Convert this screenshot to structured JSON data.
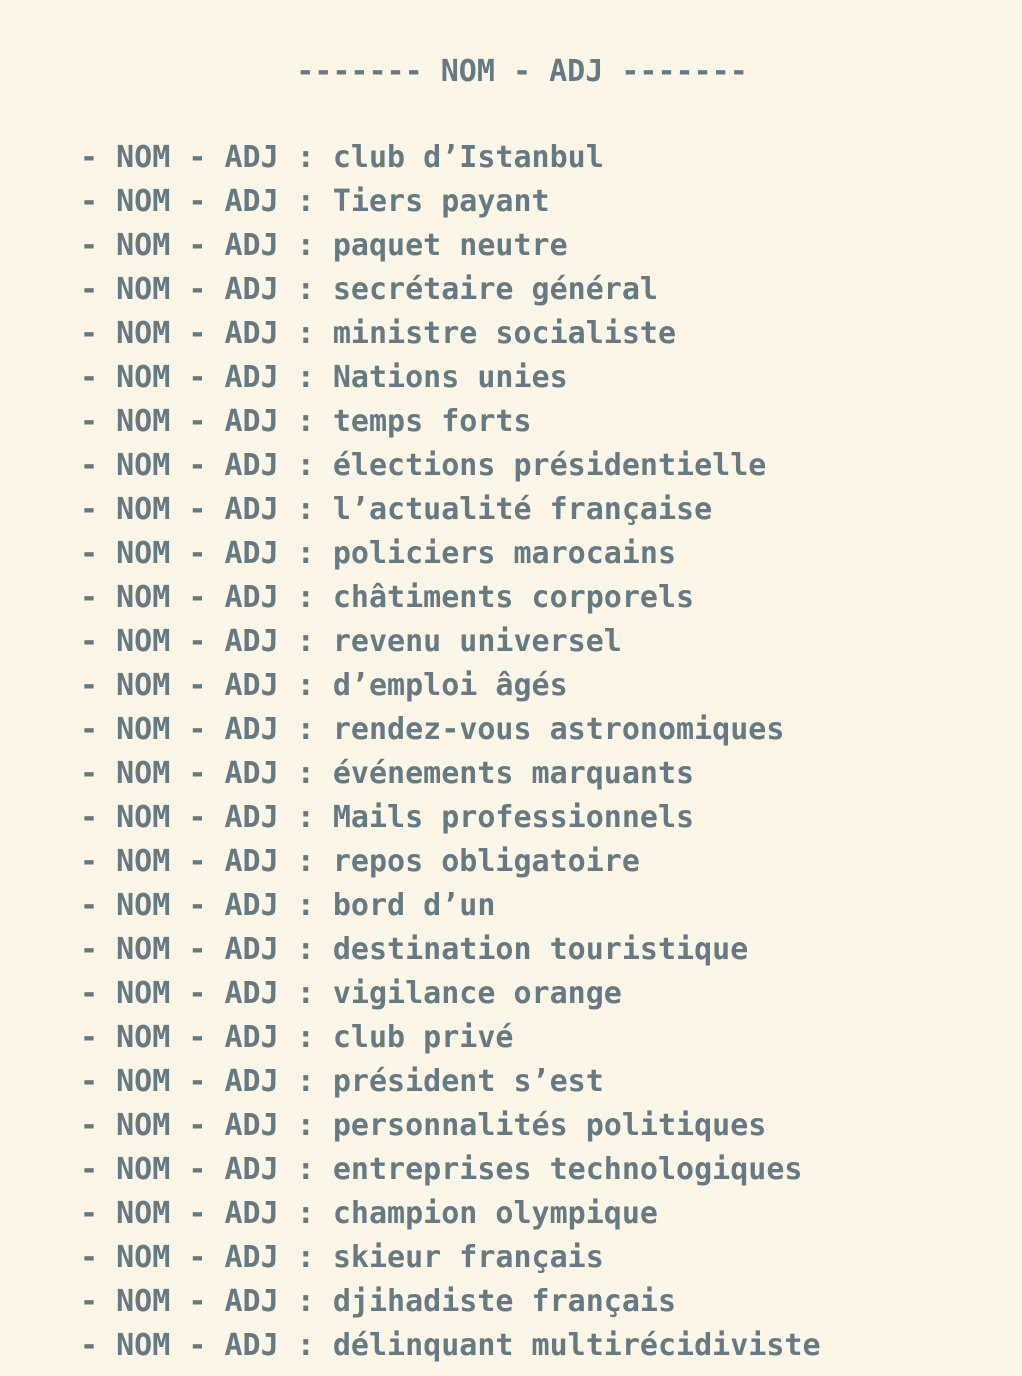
{
  "heading": "------- NOM - ADJ -------",
  "prefix": "- NOM - ADJ : ",
  "entries": [
    "club d’Istanbul",
    "Tiers payant",
    "paquet neutre",
    "secrétaire général",
    "ministre socialiste",
    "Nations unies",
    "temps forts",
    "élections présidentielle",
    "l’actualité française",
    "policiers marocains",
    "châtiments corporels",
    "revenu universel",
    "d’emploi âgés",
    "rendez-vous astronomiques",
    "événements marquants",
    "Mails professionnels",
    "repos obligatoire",
    "bord d’un",
    "destination touristique",
    "vigilance orange",
    "club privé",
    "président s’est",
    "personnalités politiques",
    "entreprises technologiques",
    "champion olympique",
    "skieur français",
    "djihadiste français",
    "délinquant multirécidiviste"
  ]
}
